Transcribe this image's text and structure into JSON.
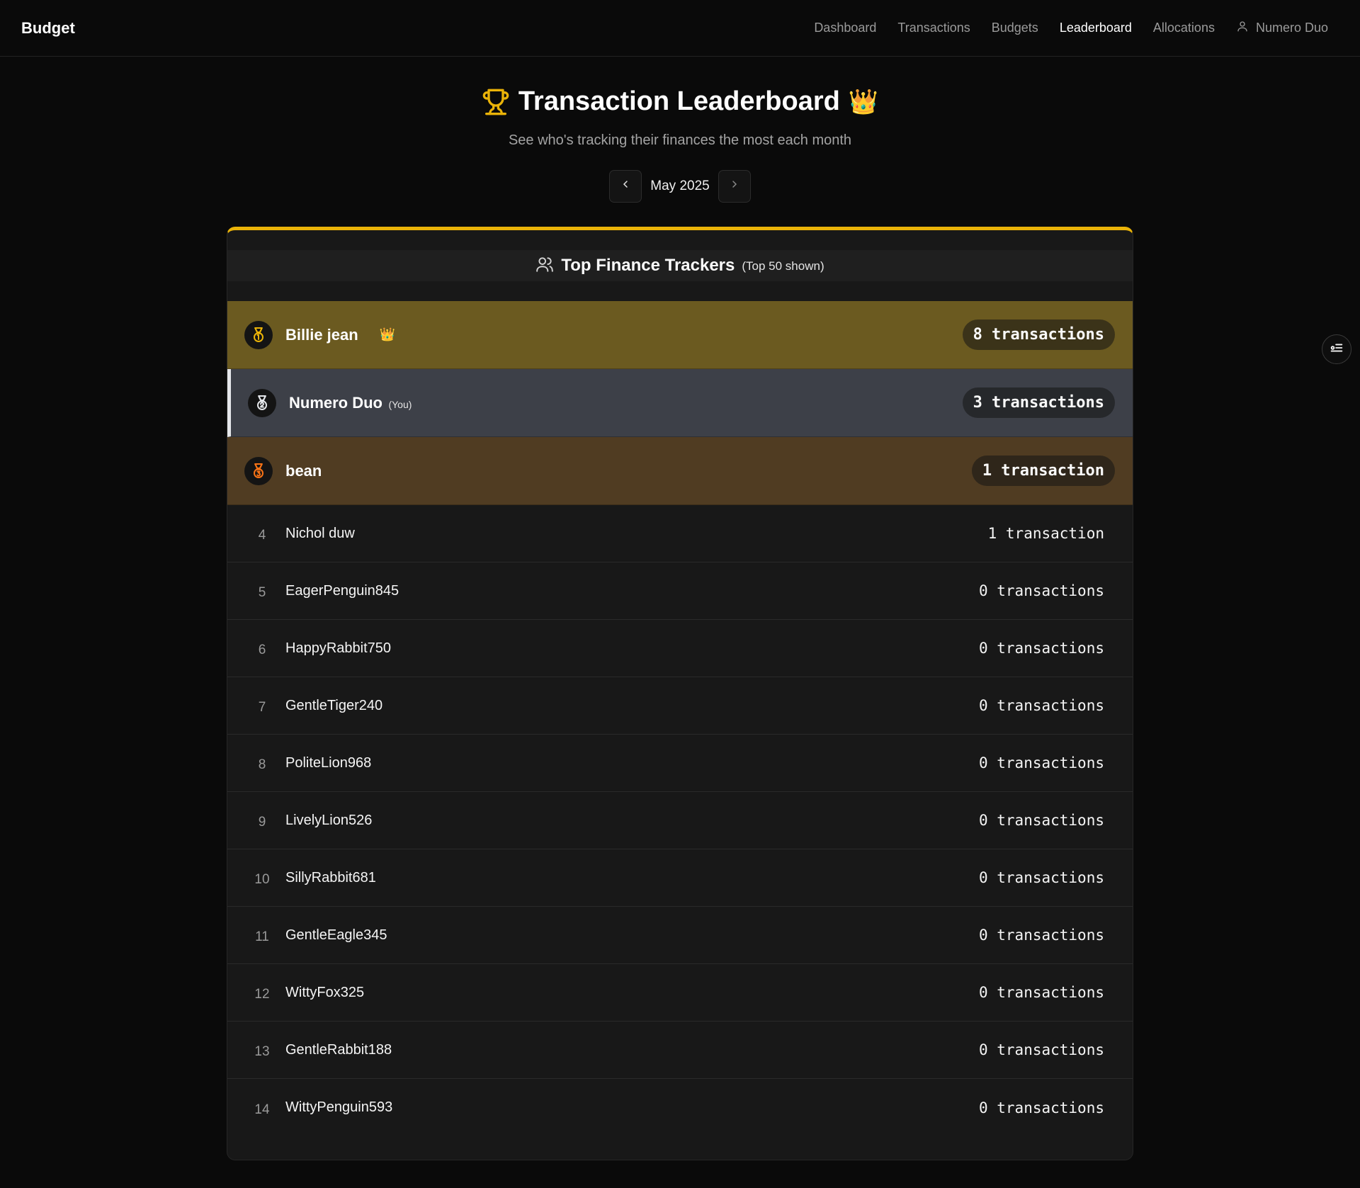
{
  "brand": "Budget",
  "nav": {
    "items": [
      "Dashboard",
      "Transactions",
      "Budgets",
      "Leaderboard",
      "Allocations"
    ],
    "active": "Leaderboard",
    "user": "Numero Duo"
  },
  "header": {
    "title": "Transaction Leaderboard",
    "crown_emoji": "👑",
    "subtitle": "See who's tracking their finances the most each month",
    "month": "May 2025"
  },
  "card": {
    "title": "Top Finance Trackers",
    "note": "(Top 50 shown)"
  },
  "top3": [
    {
      "name": "Billie jean",
      "count": "8 transactions",
      "medal": "gold",
      "crown": "👑"
    },
    {
      "name": "Numero Duo",
      "you_tag": "(You)",
      "count": "3 transactions",
      "medal": "silver"
    },
    {
      "name": "bean",
      "count": "1 transaction",
      "medal": "bronze"
    }
  ],
  "rows": [
    {
      "rank": "4",
      "name": "Nichol duw",
      "count": "1 transaction"
    },
    {
      "rank": "5",
      "name": "EagerPenguin845",
      "count": "0 transactions"
    },
    {
      "rank": "6",
      "name": "HappyRabbit750",
      "count": "0 transactions"
    },
    {
      "rank": "7",
      "name": "GentleTiger240",
      "count": "0 transactions"
    },
    {
      "rank": "8",
      "name": "PoliteLion968",
      "count": "0 transactions"
    },
    {
      "rank": "9",
      "name": "LivelyLion526",
      "count": "0 transactions"
    },
    {
      "rank": "10",
      "name": "SillyRabbit681",
      "count": "0 transactions"
    },
    {
      "rank": "11",
      "name": "GentleEagle345",
      "count": "0 transactions"
    },
    {
      "rank": "12",
      "name": "WittyFox325",
      "count": "0 transactions"
    },
    {
      "rank": "13",
      "name": "GentleRabbit188",
      "count": "0 transactions"
    },
    {
      "rank": "14",
      "name": "WittyPenguin593",
      "count": "0 transactions"
    }
  ],
  "colors": {
    "accent": "#eab308",
    "gold_row": "#6b5a20",
    "silver_row": "#3d4048",
    "bronze_row": "#503c22",
    "medal_gold": "#eab308",
    "medal_silver": "#e5e7eb",
    "medal_bronze": "#f97316"
  }
}
